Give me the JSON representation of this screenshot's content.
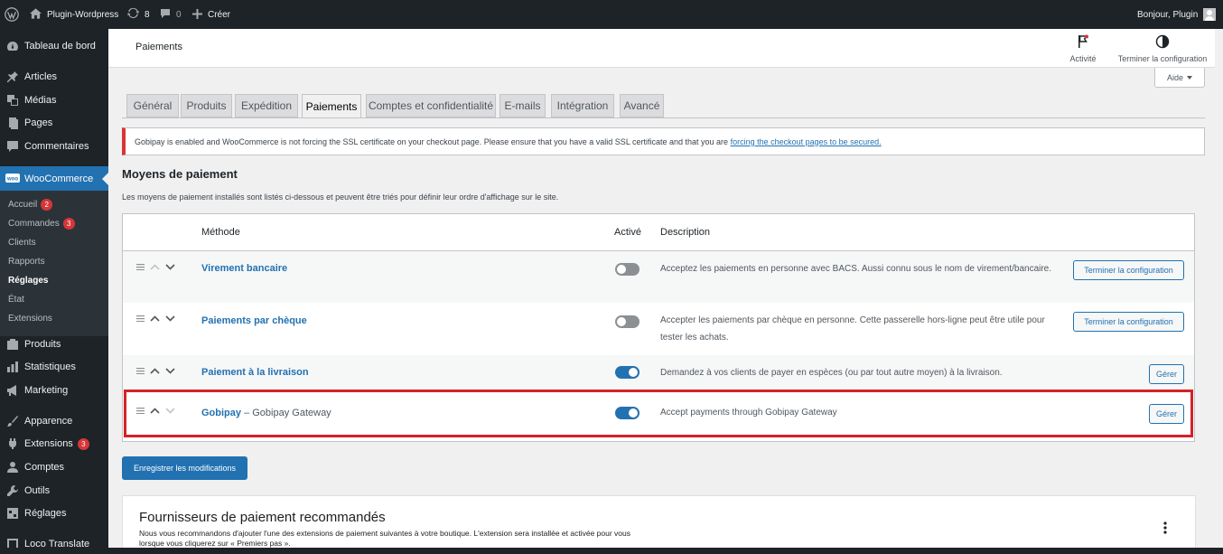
{
  "admin_bar": {
    "site_name": "Plugin-Wordpress",
    "updates_count": "8",
    "comments_count": "0",
    "new_label": "Créer",
    "greeting": "Bonjour, Plugin"
  },
  "sidebar": {
    "items": [
      {
        "label": "Tableau de bord",
        "icon": "dashboard-icon"
      },
      {
        "label": "Articles",
        "icon": "pin-icon"
      },
      {
        "label": "Médias",
        "icon": "media-icon"
      },
      {
        "label": "Pages",
        "icon": "page-icon"
      },
      {
        "label": "Commentaires",
        "icon": "comment-icon"
      },
      {
        "label": "WooCommerce",
        "icon": "woo-icon"
      },
      {
        "label": "Produits",
        "icon": "products-icon"
      },
      {
        "label": "Statistiques",
        "icon": "stats-icon"
      },
      {
        "label": "Marketing",
        "icon": "megaphone-icon"
      },
      {
        "label": "Apparence",
        "icon": "brush-icon"
      },
      {
        "label": "Extensions",
        "icon": "plugin-icon",
        "badge": "3"
      },
      {
        "label": "Comptes",
        "icon": "user-icon"
      },
      {
        "label": "Outils",
        "icon": "wrench-icon"
      },
      {
        "label": "Réglages",
        "icon": "settings-icon"
      },
      {
        "label": "Loco Translate",
        "icon": "translate-icon"
      }
    ],
    "submenu": [
      {
        "label": "Accueil",
        "badge": "2"
      },
      {
        "label": "Commandes",
        "badge": "3"
      },
      {
        "label": "Clients"
      },
      {
        "label": "Rapports"
      },
      {
        "label": "Réglages"
      },
      {
        "label": "État"
      },
      {
        "label": "Extensions"
      }
    ]
  },
  "header": {
    "title": "Paiements",
    "activity_label": "Activité",
    "finish_setup_label": "Terminer la configuration",
    "help_label": "Aide"
  },
  "tabs": [
    "Général",
    "Produits",
    "Expédition",
    "Paiements",
    "Comptes et confidentialité",
    "E-mails",
    "Intégration",
    "Avancé"
  ],
  "notice": {
    "text": "Gobipay is enabled and WooCommerce is not forcing the SSL certificate on your checkout page. Please ensure that you have a valid SSL certificate and that you are ",
    "link": "forcing the checkout pages to be secured."
  },
  "section": {
    "title": "Moyens de paiement",
    "description": "Les moyens de paiement installés sont listés ci-dessous et peuvent être triés pour définir leur ordre d'affichage sur le site."
  },
  "table": {
    "headers": {
      "method": "Méthode",
      "enabled": "Activé",
      "description": "Description"
    },
    "rows": [
      {
        "name": "Virement bancaire",
        "subtitle": "",
        "enabled": false,
        "description": "Acceptez les paiements en personne avec BACS. Aussi connu sous le nom de virement/bancaire.",
        "action": "Terminer la configuration"
      },
      {
        "name": "Paiements par chèque",
        "subtitle": "",
        "enabled": false,
        "description": "Accepter les paiements par chèque en personne. Cette passerelle hors-ligne peut être utile pour tester les achats.",
        "action": "Terminer la configuration"
      },
      {
        "name": "Paiement à la livraison",
        "subtitle": "",
        "enabled": true,
        "description": "Demandez à vos clients de payer en espèces (ou par tout autre moyen) à la livraison.",
        "action": "Gérer"
      },
      {
        "name": "Gobipay",
        "subtitle": " – Gobipay Gateway",
        "enabled": true,
        "description": "Accept payments through Gobipay Gateway",
        "action": "Gérer"
      }
    ]
  },
  "save_label": "Enregistrer les modifications",
  "recommended": {
    "title": "Fournisseurs de paiement recommandés",
    "description": "Nous vous recommandons d'ajouter l'une des extensions de paiement suivantes à votre boutique. L'extension sera installée et activée pour vous lorsque vous cliquerez sur « Premiers pas »."
  },
  "colors": {
    "accent": "#2271b1",
    "admin_dark": "#1d2327",
    "highlight": "#d42227"
  }
}
